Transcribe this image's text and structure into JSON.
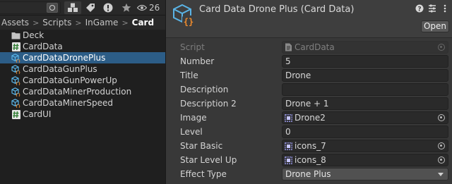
{
  "project": {
    "toolbar": {
      "search_value": "",
      "hidden_count": "26"
    },
    "breadcrumb": [
      {
        "label": "Assets",
        "current": false
      },
      {
        "label": "Scripts",
        "current": false
      },
      {
        "label": "InGame",
        "current": false
      },
      {
        "label": "Card",
        "current": true
      }
    ],
    "items": [
      {
        "label": "Deck",
        "icon": "folder-icon",
        "selected": false
      },
      {
        "label": "CardData",
        "icon": "csharp-script-icon",
        "selected": false
      },
      {
        "label": "CardDataDronePlus",
        "icon": "scriptable-object-icon",
        "selected": true
      },
      {
        "label": "CardDataGunPlus",
        "icon": "scriptable-object-icon",
        "selected": false
      },
      {
        "label": "CardDataGunPowerUp",
        "icon": "scriptable-object-icon",
        "selected": false
      },
      {
        "label": "CardDataMinerProduction",
        "icon": "scriptable-object-icon",
        "selected": false
      },
      {
        "label": "CardDataMinerSpeed",
        "icon": "scriptable-object-icon",
        "selected": false
      },
      {
        "label": "CardUI",
        "icon": "csharp-script-icon",
        "selected": false
      }
    ]
  },
  "inspector": {
    "title": "Card Data Drone Plus (Card Data)",
    "open_label": "Open",
    "properties": [
      {
        "label": "Script",
        "value": "CardData",
        "kind": "object",
        "disabled": true,
        "ref_icon": "script-ref-icon"
      },
      {
        "label": "Number",
        "value": "5",
        "kind": "text"
      },
      {
        "label": "Title",
        "value": "Drone",
        "kind": "text"
      },
      {
        "label": "Description",
        "value": "",
        "kind": "text"
      },
      {
        "label": "Description 2",
        "value": "Drone + 1",
        "kind": "text"
      },
      {
        "label": "Image",
        "value": "Drone2",
        "kind": "object",
        "ref_icon": "sprite-ref-icon"
      },
      {
        "label": "Level",
        "value": "0",
        "kind": "text"
      },
      {
        "label": "Star Basic",
        "value": "icons_7",
        "kind": "object",
        "ref_icon": "sprite-ref-icon"
      },
      {
        "label": "Star Level Up",
        "value": "icons_8",
        "kind": "object",
        "ref_icon": "sprite-ref-icon"
      },
      {
        "label": "Effect Type",
        "value": "Drone Plus",
        "kind": "dropdown"
      }
    ]
  },
  "colors": {
    "selection": "#2c5d87",
    "asset_icon_blue": "#5ab4e6",
    "asset_icon_orange": "#f08c2d"
  }
}
